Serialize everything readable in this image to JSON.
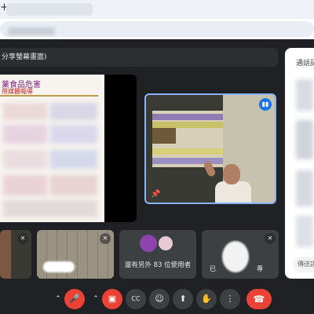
{
  "browser": {
    "new_tab_icon": "plus-icon"
  },
  "presentation": {
    "banner": "分享螢幕畫面)",
    "doc_title": "業食品危害",
    "doc_subtitle": "用媒體報導"
  },
  "side_panel": {
    "title": "通話記",
    "input_placeholder": "傳送訊"
  },
  "tiles": {
    "others_count_text": "還有另外 83 位使用者",
    "name_fragment_left": "已",
    "name_fragment_right": "專"
  },
  "controls": {
    "cc_label": "CC",
    "mic_state": "muted",
    "camera_state": "off"
  },
  "colors": {
    "accent": "#1a73e8",
    "danger": "#ea4335",
    "meet_bg": "#202124",
    "tile_bg": "#3c4043"
  }
}
